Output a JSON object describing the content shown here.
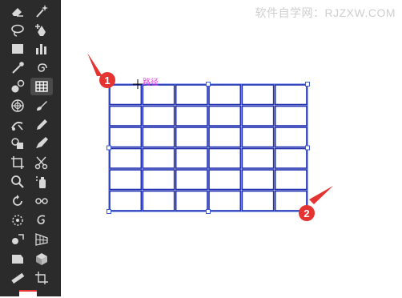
{
  "watermark": "软件自学网：RJZXW.COM",
  "canvas": {
    "path_label": "路径",
    "grid": {
      "rows": 6,
      "columns": 6,
      "stroke_color": "#1f2fb0",
      "selection_color": "#3b5bd6"
    },
    "callouts": [
      {
        "label": "1",
        "color": "#e43330"
      },
      {
        "label": "2",
        "color": "#e43330"
      }
    ]
  },
  "tools": [
    {
      "name": "eraser-tool-icon",
      "active": false
    },
    {
      "name": "magic-wand-tool-icon",
      "active": false
    },
    {
      "name": "lasso-tool-icon",
      "active": false
    },
    {
      "name": "pen-add-tool-icon",
      "active": false
    },
    {
      "name": "rectangle-tool-icon",
      "active": false
    },
    {
      "name": "column-graph-tool-icon",
      "active": false
    },
    {
      "name": "eyedropper-tool-icon",
      "active": false
    },
    {
      "name": "spiral-tool-icon",
      "active": false
    },
    {
      "name": "blend-tool-icon",
      "active": false
    },
    {
      "name": "rectangular-grid-tool-icon",
      "active": true
    },
    {
      "name": "polar-grid-tool-icon",
      "active": false
    },
    {
      "name": "paintbrush-tool-icon",
      "active": false
    },
    {
      "name": "puppet-warp-tool-icon",
      "active": false
    },
    {
      "name": "pencil-tool-icon",
      "active": false
    },
    {
      "name": "shape-builder-tool-icon",
      "active": false
    },
    {
      "name": "blob-brush-tool-icon",
      "active": false
    },
    {
      "name": "crop-tool-icon",
      "active": false
    },
    {
      "name": "scissors-tool-icon",
      "active": false
    },
    {
      "name": "zoom-tool-icon",
      "active": false
    },
    {
      "name": "symbol-sprayer-tool-icon",
      "active": false
    },
    {
      "name": "rotate-tool-icon",
      "active": false
    },
    {
      "name": "width-tool-icon",
      "active": false
    },
    {
      "name": "warp-tool-icon",
      "active": false
    },
    {
      "name": "twirl-tool-icon",
      "active": false
    },
    {
      "name": "free-transform-tool-icon",
      "active": false
    },
    {
      "name": "perspective-grid-tool-icon",
      "active": false
    },
    {
      "name": "slice-tool-icon",
      "active": false
    },
    {
      "name": "live-paint-tool-icon",
      "active": false
    },
    {
      "name": "measure-tool-icon",
      "active": false
    },
    {
      "name": "artboard-tool-icon",
      "active": false
    }
  ]
}
